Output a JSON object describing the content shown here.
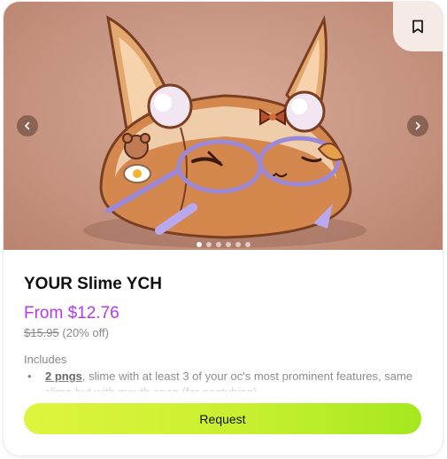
{
  "product": {
    "title": "YOUR Slime YCH",
    "price_label": "From $12.76",
    "original_price": "$15.95",
    "discount_note": "(20% off)",
    "includes_heading": "Includes",
    "includes_items": [
      {
        "strong": "2 pngs",
        "text": ", slime with at least 3 of your oc's most prominent features, same slime but with mouth open (for pngtubing)"
      }
    ],
    "request_label": "Request"
  },
  "carousel": {
    "slide_count": 6,
    "active_index": 0
  },
  "icons": {
    "bookmark": "bookmark-icon",
    "prev": "chevron-left-icon",
    "next": "chevron-right-icon"
  },
  "colors": {
    "price": "#b43be6",
    "button_start": "#dff43e",
    "button_end": "#a5e81f"
  }
}
